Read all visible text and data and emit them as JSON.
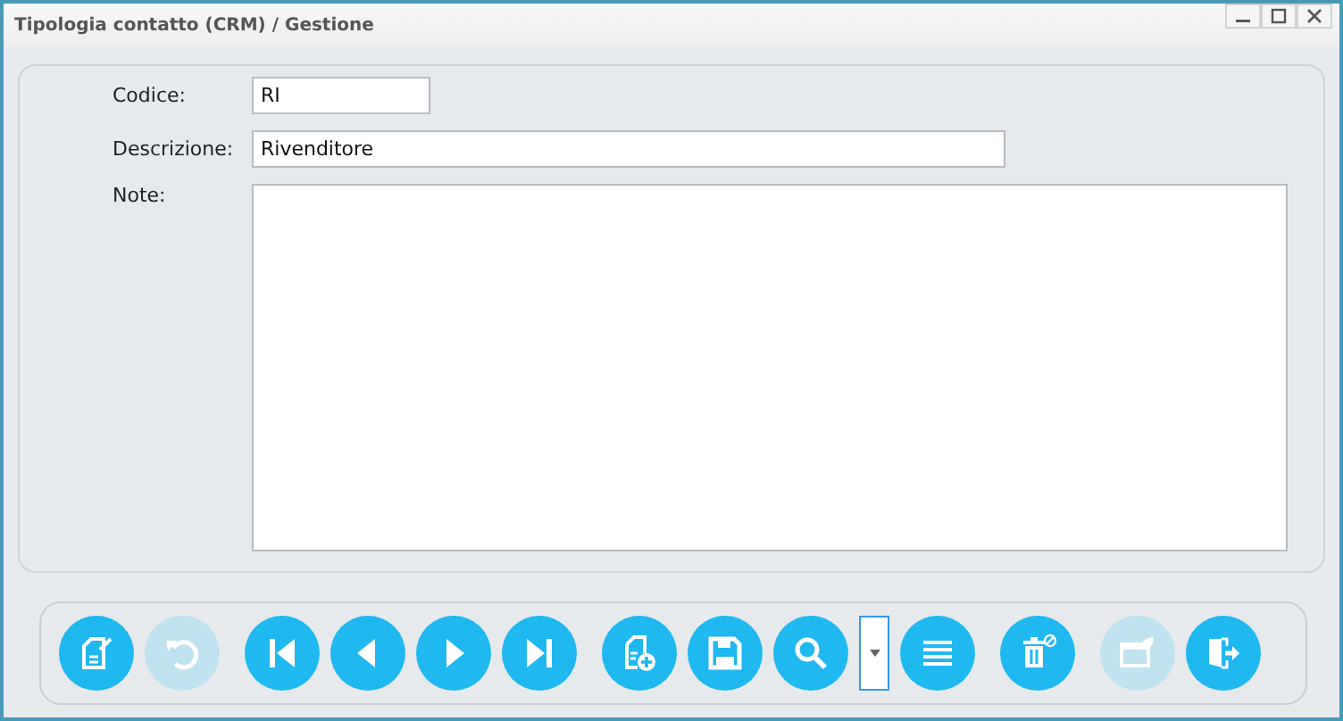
{
  "window": {
    "title": "Tipologia contatto (CRM) / Gestione"
  },
  "form": {
    "fields": [
      {
        "label": "Codice:",
        "value": "RI",
        "kind": "short"
      },
      {
        "label": "Descrizione:",
        "value": "Rivenditore",
        "kind": "long"
      },
      {
        "label": "Note:",
        "kind": "area"
      }
    ]
  },
  "toolbar": {
    "groups": [
      [
        {
          "kind": "edit",
          "disabled": false
        },
        {
          "kind": "undo",
          "disabled": true
        }
      ],
      [
        {
          "kind": "first",
          "disabled": false
        },
        {
          "kind": "prev",
          "disabled": false
        },
        {
          "kind": "next",
          "disabled": false
        },
        {
          "kind": "last",
          "disabled": false
        }
      ],
      [
        {
          "kind": "new",
          "disabled": false
        },
        {
          "kind": "save",
          "disabled": false
        },
        {
          "kind": "search",
          "disabled": false
        },
        {
          "kind": "dropdown",
          "disabled": false
        },
        {
          "kind": "list",
          "disabled": false
        }
      ],
      [
        {
          "kind": "delete",
          "disabled": false
        }
      ],
      [
        {
          "kind": "export",
          "disabled": true
        },
        {
          "kind": "exit",
          "disabled": false
        }
      ]
    ]
  }
}
